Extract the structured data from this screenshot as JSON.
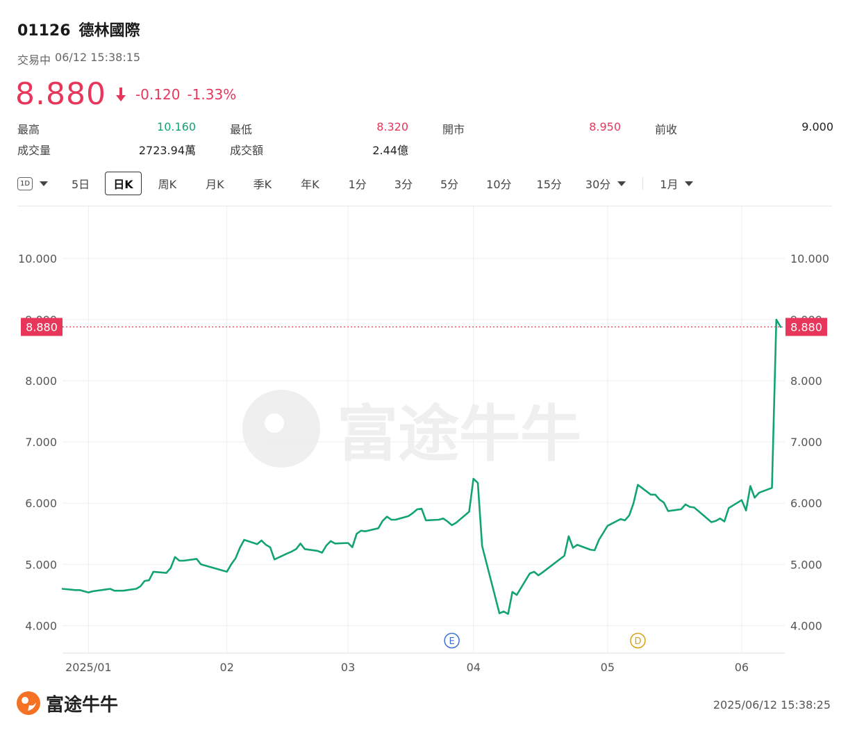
{
  "header": {
    "code": "01126",
    "name": "德林國際"
  },
  "status": {
    "state": "交易中",
    "datetime": "06/12 15:38:15"
  },
  "quote": {
    "price": "8.880",
    "change": "-0.120",
    "change_pct": "-1.33%"
  },
  "stats": [
    [
      {
        "label": "最高",
        "value": "10.160",
        "tone": "up"
      },
      {
        "label": "最低",
        "value": "8.320",
        "tone": "down"
      },
      {
        "label": "開市",
        "value": "8.950",
        "tone": "down"
      },
      {
        "label": "前收",
        "value": "9.000",
        "tone": ""
      }
    ],
    [
      {
        "label": "成交量",
        "value": "2723.94萬",
        "tone": ""
      },
      {
        "label": "成交額",
        "value": "2.44億",
        "tone": ""
      }
    ]
  ],
  "toolbar": {
    "d1_label": "1D",
    "items": [
      "5日",
      "日K",
      "周K",
      "月K",
      "季K",
      "年K",
      "1分",
      "3分",
      "5分",
      "10分",
      "15分",
      "30分"
    ],
    "active": "日K",
    "range_label": "1月"
  },
  "colors": {
    "up": "#12a372",
    "down": "#e8365b",
    "line": "#12a372",
    "grid": "#eeeeee"
  },
  "chart_data": {
    "type": "line",
    "title": "",
    "xlabel": "",
    "ylabel": "",
    "ylim": [
      3.55,
      10.85
    ],
    "y_ticks": [
      "4.000",
      "5.000",
      "6.000",
      "7.000",
      "8.000",
      "9.000",
      "10.000"
    ],
    "x_ticks": [
      {
        "label": "2025/01",
        "date": "2025-01-02"
      },
      {
        "label": "02",
        "date": "2025-02-03"
      },
      {
        "label": "03",
        "date": "2025-03-03"
      },
      {
        "label": "04",
        "date": "2025-04-01"
      },
      {
        "label": "05",
        "date": "2025-05-02"
      },
      {
        "label": "06",
        "date": "2025-06-02"
      }
    ],
    "last_price_label": "8.880",
    "last_price": 8.88,
    "grid": true,
    "markers": [
      {
        "label": "E",
        "date": "2025-03-27",
        "color": "#3b6fd9"
      },
      {
        "label": "D",
        "date": "2025-05-09",
        "color": "#d6a214"
      }
    ],
    "series": [
      {
        "points": [
          [
            "2024-12-27",
            4.6
          ],
          [
            "2024-12-30",
            4.58
          ],
          [
            "2024-12-31",
            4.58
          ],
          [
            "2025-01-02",
            4.54
          ],
          [
            "2025-01-03",
            4.56
          ],
          [
            "2025-01-06",
            4.59
          ],
          [
            "2025-01-07",
            4.6
          ],
          [
            "2025-01-08",
            4.57
          ],
          [
            "2025-01-09",
            4.57
          ],
          [
            "2025-01-10",
            4.57
          ],
          [
            "2025-01-13",
            4.6
          ],
          [
            "2025-01-14",
            4.64
          ],
          [
            "2025-01-15",
            4.73
          ],
          [
            "2025-01-16",
            4.74
          ],
          [
            "2025-01-17",
            4.88
          ],
          [
            "2025-01-20",
            4.86
          ],
          [
            "2025-01-21",
            4.94
          ],
          [
            "2025-01-22",
            5.12
          ],
          [
            "2025-01-23",
            5.06
          ],
          [
            "2025-01-24",
            5.06
          ],
          [
            "2025-01-27",
            5.09
          ],
          [
            "2025-01-28",
            5.0
          ],
          [
            "2025-02-03",
            4.88
          ],
          [
            "2025-02-04",
            5.0
          ],
          [
            "2025-02-05",
            5.1
          ],
          [
            "2025-02-06",
            5.27
          ],
          [
            "2025-02-07",
            5.4
          ],
          [
            "2025-02-10",
            5.33
          ],
          [
            "2025-02-11",
            5.39
          ],
          [
            "2025-02-12",
            5.32
          ],
          [
            "2025-02-13",
            5.28
          ],
          [
            "2025-02-14",
            5.08
          ],
          [
            "2025-02-17",
            5.18
          ],
          [
            "2025-02-18",
            5.21
          ],
          [
            "2025-02-19",
            5.25
          ],
          [
            "2025-02-20",
            5.34
          ],
          [
            "2025-02-21",
            5.25
          ],
          [
            "2025-02-24",
            5.22
          ],
          [
            "2025-02-25",
            5.19
          ],
          [
            "2025-02-26",
            5.31
          ],
          [
            "2025-02-27",
            5.38
          ],
          [
            "2025-02-28",
            5.34
          ],
          [
            "2025-03-03",
            5.35
          ],
          [
            "2025-03-04",
            5.28
          ],
          [
            "2025-03-05",
            5.5
          ],
          [
            "2025-03-06",
            5.55
          ],
          [
            "2025-03-07",
            5.54
          ],
          [
            "2025-03-10",
            5.59
          ],
          [
            "2025-03-11",
            5.71
          ],
          [
            "2025-03-12",
            5.78
          ],
          [
            "2025-03-13",
            5.73
          ],
          [
            "2025-03-14",
            5.73
          ],
          [
            "2025-03-17",
            5.79
          ],
          [
            "2025-03-18",
            5.84
          ],
          [
            "2025-03-19",
            5.9
          ],
          [
            "2025-03-20",
            5.91
          ],
          [
            "2025-03-21",
            5.72
          ],
          [
            "2025-03-24",
            5.73
          ],
          [
            "2025-03-25",
            5.75
          ],
          [
            "2025-03-26",
            5.7
          ],
          [
            "2025-03-27",
            5.64
          ],
          [
            "2025-03-28",
            5.68
          ],
          [
            "2025-03-31",
            5.86
          ],
          [
            "2025-04-01",
            6.4
          ],
          [
            "2025-04-02",
            6.33
          ],
          [
            "2025-04-03",
            5.3
          ],
          [
            "2025-04-07",
            4.2
          ],
          [
            "2025-04-08",
            4.23
          ],
          [
            "2025-04-09",
            4.19
          ],
          [
            "2025-04-10",
            4.55
          ],
          [
            "2025-04-11",
            4.5
          ],
          [
            "2025-04-14",
            4.85
          ],
          [
            "2025-04-15",
            4.88
          ],
          [
            "2025-04-16",
            4.82
          ],
          [
            "2025-04-17",
            4.87
          ],
          [
            "2025-04-22",
            5.14
          ],
          [
            "2025-04-23",
            5.46
          ],
          [
            "2025-04-24",
            5.27
          ],
          [
            "2025-04-25",
            5.32
          ],
          [
            "2025-04-28",
            5.24
          ],
          [
            "2025-04-29",
            5.23
          ],
          [
            "2025-04-30",
            5.4
          ],
          [
            "2025-05-02",
            5.63
          ],
          [
            "2025-05-05",
            5.74
          ],
          [
            "2025-05-06",
            5.72
          ],
          [
            "2025-05-07",
            5.8
          ],
          [
            "2025-05-08",
            6.0
          ],
          [
            "2025-05-09",
            6.3
          ],
          [
            "2025-05-12",
            6.14
          ],
          [
            "2025-05-13",
            6.14
          ],
          [
            "2025-05-14",
            6.06
          ],
          [
            "2025-05-15",
            6.01
          ],
          [
            "2025-05-16",
            5.87
          ],
          [
            "2025-05-19",
            5.9
          ],
          [
            "2025-05-20",
            5.98
          ],
          [
            "2025-05-21",
            5.94
          ],
          [
            "2025-05-22",
            5.93
          ],
          [
            "2025-05-23",
            5.87
          ],
          [
            "2025-05-26",
            5.69
          ],
          [
            "2025-05-27",
            5.71
          ],
          [
            "2025-05-28",
            5.75
          ],
          [
            "2025-05-29",
            5.7
          ],
          [
            "2025-05-30",
            5.92
          ],
          [
            "2025-06-02",
            6.05
          ],
          [
            "2025-06-03",
            5.88
          ],
          [
            "2025-06-04",
            6.28
          ],
          [
            "2025-06-05",
            6.09
          ],
          [
            "2025-06-06",
            6.17
          ],
          [
            "2025-06-09",
            6.25
          ],
          [
            "2025-06-10",
            9.0
          ],
          [
            "2025-06-11",
            8.88
          ]
        ]
      }
    ]
  },
  "footer": {
    "brand": "富途牛牛",
    "timestamp": "2025/06/12 15:38:25"
  }
}
